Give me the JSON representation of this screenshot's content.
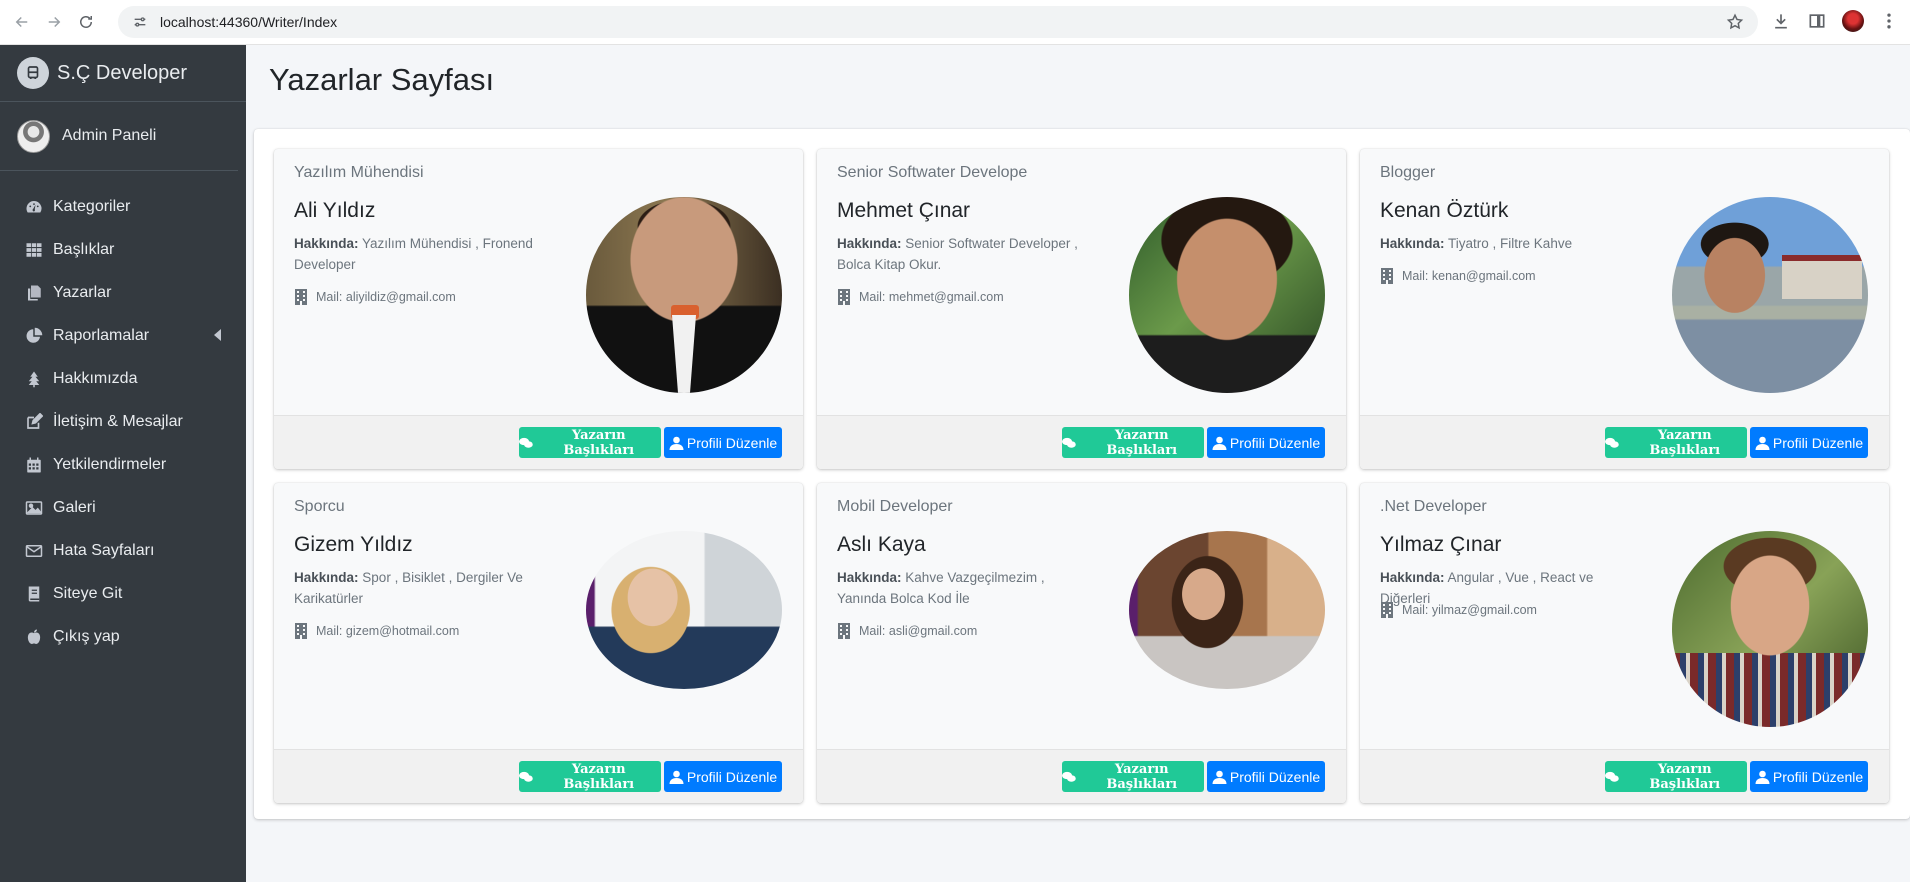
{
  "browser": {
    "url": "localhost:44360/Writer/Index"
  },
  "sidebar": {
    "brand": "S.Ç Developer",
    "user": "Admin Paneli",
    "items": [
      {
        "label": "Kategoriler",
        "icon": "dashboard-icon"
      },
      {
        "label": "Başlıklar",
        "icon": "grid-icon"
      },
      {
        "label": "Yazarlar",
        "icon": "copy-icon"
      },
      {
        "label": "Raporlamalar",
        "icon": "pie-chart-icon"
      },
      {
        "label": "Hakkımızda",
        "icon": "tree-icon"
      },
      {
        "label": "İletişim & Mesajlar",
        "icon": "edit-icon"
      },
      {
        "label": "Yetkilendirmeler",
        "icon": "calendar-icon"
      },
      {
        "label": "Galeri",
        "icon": "image-icon"
      },
      {
        "label": "Hata Sayfaları",
        "icon": "envelope-icon"
      },
      {
        "label": "Siteye Git",
        "icon": "book-icon"
      },
      {
        "label": "Çıkış yap",
        "icon": "apple-icon"
      }
    ]
  },
  "page": {
    "title": "Yazarlar Sayfası"
  },
  "writers": [
    {
      "title": "Yazılım Mühendisi",
      "name": "Ali Yıldız",
      "about_label": "Hakkında:",
      "about": "Yazılım Mühendisi , Fronend Developer",
      "mail": "Mail: aliyildiz@gmail.com",
      "btn_titles": "Yazarın Başlıkları",
      "btn_profile": "Profili Düzenle"
    },
    {
      "title": "Senior Softwater Develope",
      "name": "Mehmet Çınar",
      "about_label": "Hakkında:",
      "about": "Senior Softwater Developer , Bolca Kitap Okur.",
      "mail": "Mail: mehmet@gmail.com",
      "btn_titles": "Yazarın Başlıkları",
      "btn_profile": "Profili Düzenle"
    },
    {
      "title": "Blogger",
      "name": "Kenan Öztürk",
      "about_label": "Hakkında:",
      "about": "Tiyatro , Filtre Kahve",
      "mail": "Mail: kenan@gmail.com",
      "btn_titles": "Yazarın Başlıkları",
      "btn_profile": "Profili Düzenle"
    },
    {
      "title": "Sporcu",
      "name": "Gizem Yıldız",
      "about_label": "Hakkında:",
      "about": "Spor , Bisiklet , Dergiler Ve Karikatürler",
      "mail": "Mail: gizem@hotmail.com",
      "btn_titles": "Yazarın Başlıkları",
      "btn_profile": "Profili Düzenle"
    },
    {
      "title": "Mobil Developer",
      "name": "Aslı Kaya",
      "about_label": "Hakkında:",
      "about": "Kahve Vazgeçilmezim , Yanında Bolca Kod İle",
      "mail": "Mail: asli@gmail.com",
      "btn_titles": "Yazarın Başlıkları",
      "btn_profile": "Profili Düzenle"
    },
    {
      "title": ".Net Developer",
      "name": "Yılmaz Çınar",
      "about_label": "Hakkında:",
      "about": "Angular , Vue , React ve Diğerleri",
      "mail": "Mail: yilmaz@gmail.com",
      "btn_titles": "Yazarın Başlıkları",
      "btn_profile": "Profili Düzenle"
    }
  ],
  "colors": {
    "sidebar_bg": "#343a40",
    "accent_green": "#20c997",
    "accent_blue": "#007bff"
  }
}
